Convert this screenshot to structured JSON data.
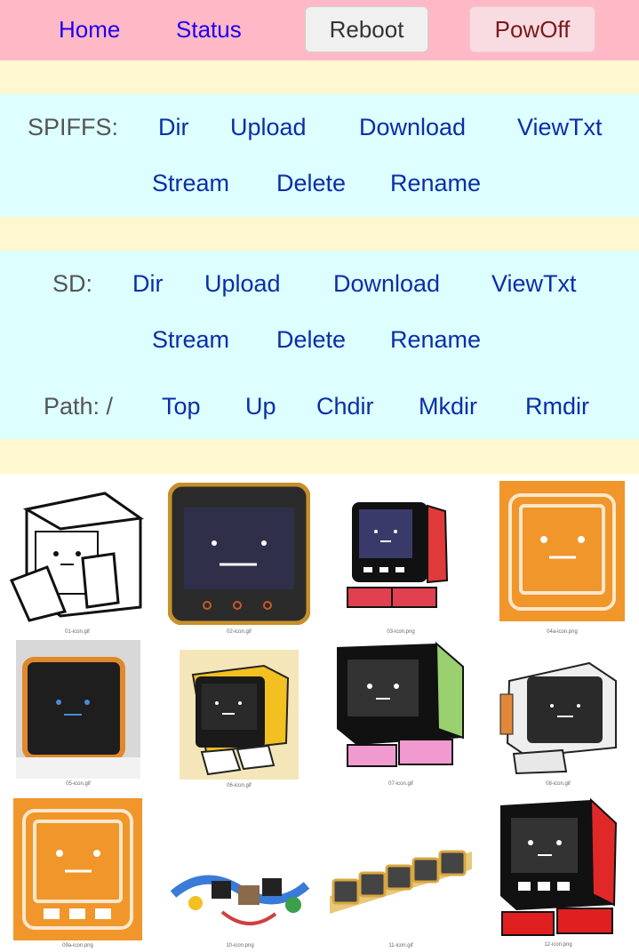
{
  "nav": {
    "home": "Home",
    "status": "Status",
    "reboot": "Reboot",
    "powoff": "PowOff"
  },
  "spiffs": {
    "label": "SPIFFS:",
    "dir": "Dir",
    "upload": "Upload",
    "download": "Download",
    "viewtxt": "ViewTxt",
    "stream": "Stream",
    "delete": "Delete",
    "rename": "Rename"
  },
  "sd": {
    "label": "SD:",
    "dir": "Dir",
    "upload": "Upload",
    "download": "Download",
    "viewtxt": "ViewTxt",
    "stream": "Stream",
    "delete": "Delete",
    "rename": "Rename",
    "path_label": "Path: /",
    "top": "Top",
    "up": "Up",
    "chdir": "Chdir",
    "mkdir": "Mkdir",
    "rmdir": "Rmdir"
  },
  "gallery": {
    "items": [
      {
        "caption": "01-icon.gif"
      },
      {
        "caption": "02-icon.gif"
      },
      {
        "caption": "03-icon.png"
      },
      {
        "caption": "04a-icon.png"
      },
      {
        "caption": "05-icon.gif"
      },
      {
        "caption": "06-icon.gif"
      },
      {
        "caption": "07-icon.gif"
      },
      {
        "caption": "08-icon.gif"
      },
      {
        "caption": "09a-icon.png"
      },
      {
        "caption": "10-icon.png"
      },
      {
        "caption": "11-icon.gif"
      },
      {
        "caption": "12-icon.png"
      }
    ]
  },
  "colors": {
    "topbar": "#ffb9c6",
    "band": "#fff7cf",
    "panel": "#ddffff",
    "link": "#0a2ea8",
    "orange": "#f0962a"
  }
}
